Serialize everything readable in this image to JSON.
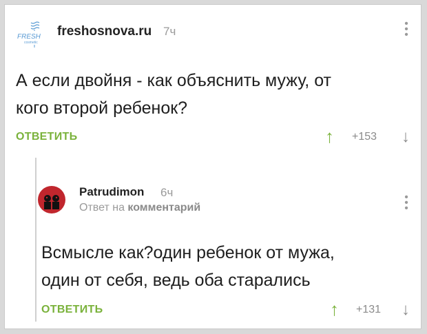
{
  "comment1": {
    "username": "freshosnova.ru",
    "time": "7ч",
    "logo_text": "FRESH",
    "logo_sub": "cosmetic",
    "text_line1": "А если двойня - как объяснить мужу, от",
    "text_line2": "кого второй ребенок?",
    "reply_label": "ОТВЕТИТЬ",
    "score": "+153"
  },
  "comment2": {
    "username": "Patrudimon",
    "time": "6ч",
    "reply_to_prefix": "Ответ на",
    "reply_to_link": "комментарий",
    "text_line1": "Всмысле как?один ребенок от мужа,",
    "text_line2": "один от себя, ведь оба старались",
    "reply_label": "ОТВЕТИТЬ",
    "score": "+131"
  },
  "colors": {
    "accent_green": "#7ab23b",
    "logo_blue": "#5a9bd4",
    "avatar_red": "#c0262d"
  },
  "icons": {
    "more": "vertical-dots-icon",
    "upvote": "arrow-up-icon",
    "downvote": "arrow-down-icon"
  }
}
